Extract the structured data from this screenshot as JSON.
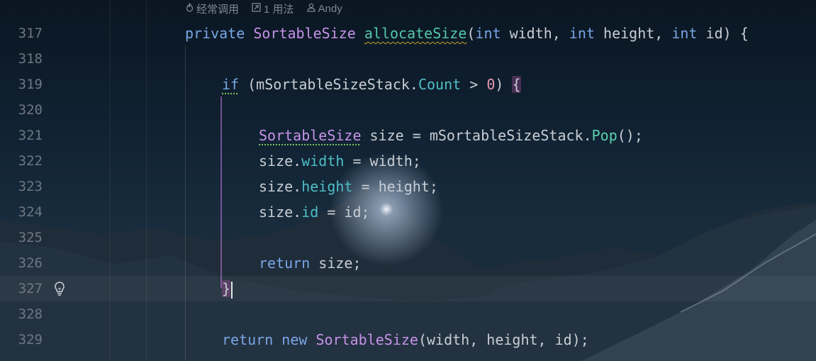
{
  "inlay_hints": {
    "usages": "经常调用",
    "usage_count": "1 用法",
    "author": "Andy"
  },
  "colors": {
    "keyword": "#7aa6e6",
    "type": "#c692e8",
    "method": "#5bd1ab",
    "property": "#4fbec6",
    "number": "#e79ab6",
    "text": "#c8cdd3",
    "line_number": "#6e7681"
  },
  "icons": {
    "usage_hint": "flame-icon",
    "usages_hint": "arrow-box-icon",
    "author_hint": "person-icon",
    "gutter": "lightbulb-icon"
  },
  "lines": [
    {
      "num": "317",
      "tokens": [
        {
          "t": "private ",
          "c": "kw"
        },
        {
          "t": "SortableSize",
          "c": "ty"
        },
        {
          "t": " ",
          "c": "txt"
        },
        {
          "t": "allocateSize",
          "c": "fn",
          "u": "squig-y"
        },
        {
          "t": "(",
          "c": "txt"
        },
        {
          "t": "int",
          "c": "kw"
        },
        {
          "t": " width, ",
          "c": "txt"
        },
        {
          "t": "int",
          "c": "kw"
        },
        {
          "t": " height, ",
          "c": "txt"
        },
        {
          "t": "int",
          "c": "kw"
        },
        {
          "t": " id) {",
          "c": "txt"
        }
      ]
    },
    {
      "num": "318",
      "tokens": []
    },
    {
      "num": "319",
      "tokens": [
        {
          "t": "if",
          "c": "kw",
          "u": "squig-g"
        },
        {
          "t": " (mSortableSizeStack.",
          "c": "txt"
        },
        {
          "t": "Count",
          "c": "prop"
        },
        {
          "t": " > ",
          "c": "txt"
        },
        {
          "t": "0",
          "c": "num"
        },
        {
          "t": ") ",
          "c": "txt"
        },
        {
          "t": "{",
          "c": "txt",
          "u": "brace-hl"
        }
      ]
    },
    {
      "num": "320",
      "tokens": []
    },
    {
      "num": "321",
      "tokens": [
        {
          "t": "SortableSize",
          "c": "ty",
          "u": "squig-g"
        },
        {
          "t": " size = mSortableSizeStack.",
          "c": "txt"
        },
        {
          "t": "Pop",
          "c": "mth"
        },
        {
          "t": "();",
          "c": "txt"
        }
      ]
    },
    {
      "num": "322",
      "tokens": [
        {
          "t": "size.",
          "c": "txt"
        },
        {
          "t": "width",
          "c": "prop"
        },
        {
          "t": " = width;",
          "c": "txt"
        }
      ]
    },
    {
      "num": "323",
      "tokens": [
        {
          "t": "size.",
          "c": "txt"
        },
        {
          "t": "height",
          "c": "prop"
        },
        {
          "t": " = height;",
          "c": "txt"
        }
      ]
    },
    {
      "num": "324",
      "tokens": [
        {
          "t": "size.",
          "c": "txt"
        },
        {
          "t": "id",
          "c": "prop"
        },
        {
          "t": " = id;",
          "c": "txt"
        }
      ]
    },
    {
      "num": "325",
      "tokens": []
    },
    {
      "num": "326",
      "tokens": [
        {
          "t": "return",
          "c": "kw"
        },
        {
          "t": " size;",
          "c": "txt"
        }
      ]
    },
    {
      "num": "327",
      "tokens": [
        {
          "t": "}",
          "c": "txt",
          "u": "brace-hl"
        }
      ],
      "caret": true
    },
    {
      "num": "328",
      "tokens": []
    },
    {
      "num": "329",
      "tokens": [
        {
          "t": "return",
          "c": "kw"
        },
        {
          "t": " ",
          "c": "txt"
        },
        {
          "t": "new",
          "c": "kw"
        },
        {
          "t": " ",
          "c": "txt"
        },
        {
          "t": "SortableSize",
          "c": "ty"
        },
        {
          "t": "(width, height, id);",
          "c": "txt"
        }
      ]
    }
  ]
}
